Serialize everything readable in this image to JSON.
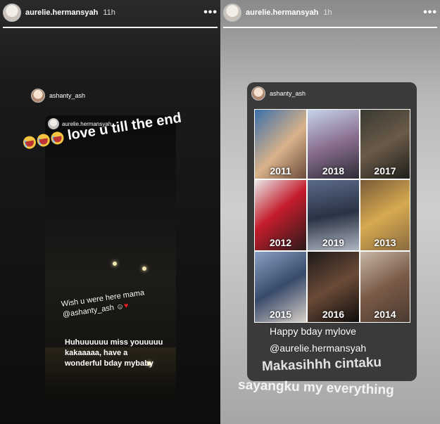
{
  "left": {
    "username": "aurelie.hermansyah",
    "time": "11h",
    "more": "•••",
    "shared_user": "ashanty_ash",
    "inner_user": "aurelie.hermansyah",
    "sticker_text": "love u till the end",
    "wish_line1": "Wish u were here mama",
    "wish_line2": "@ashanty_ash",
    "reply": [
      "Huhuuuuuu miss youuuuu",
      "kakaaaaa, have a",
      "wonderful bday mybaby"
    ]
  },
  "right": {
    "username": "aurelie.hermansyah",
    "time": "1h",
    "more": "•••",
    "shared_user": "ashanty_ash",
    "years": [
      "2011",
      "2018",
      "2017",
      "2012",
      "2019",
      "2013",
      "2015",
      "2016",
      "2014"
    ],
    "caption1": "Happy bday mylove",
    "caption2": "@aurelie.hermansyah",
    "caption3": "Makasihhh cintaku",
    "caption4": "sayangku my everything"
  },
  "colors": {
    "heart": "#e02020",
    "emoji": "#f5c542"
  }
}
